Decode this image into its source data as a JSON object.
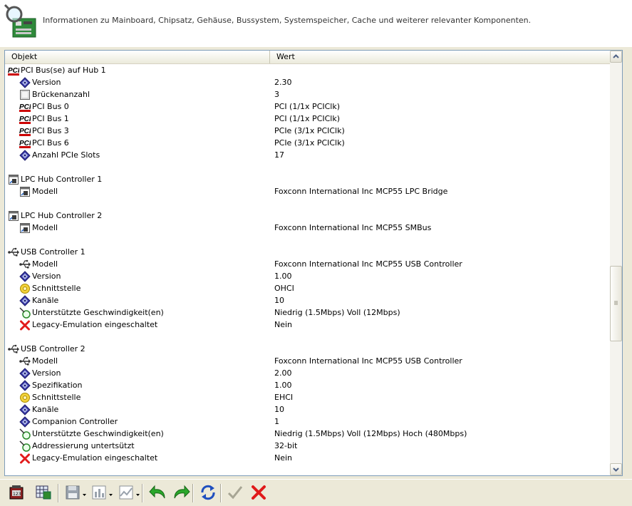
{
  "header": {
    "description": "Informationen zu Mainboard, Chipsatz, Gehäuse, Bussystem, Systemspeicher, Cache und weiterer relevanter Komponenten."
  },
  "columns": {
    "object": "Objekt",
    "value": "Wert"
  },
  "rows": [
    {
      "label": "PCI Bus(se) auf Hub 1",
      "value": "",
      "icon": "pci-icon",
      "level": 0
    },
    {
      "label": "Version",
      "value": "2.30",
      "icon": "diamond-info-icon",
      "level": 1
    },
    {
      "label": "Brückenanzahl",
      "value": "3",
      "icon": "square-gray-icon",
      "level": 1
    },
    {
      "label": "PCI Bus 0",
      "value": "PCI (1/1x PCIClk)",
      "icon": "pci-icon",
      "level": 1
    },
    {
      "label": "PCI Bus 1",
      "value": "PCI (1/1x PCIClk)",
      "icon": "pci-icon",
      "level": 1
    },
    {
      "label": "PCI Bus 3",
      "value": "PCIe (3/1x PCIClk)",
      "icon": "pci-icon",
      "level": 1
    },
    {
      "label": "PCI Bus 6",
      "value": "PCIe (3/1x PCIClk)",
      "icon": "pci-icon",
      "level": 1
    },
    {
      "label": "Anzahl PCIe Slots",
      "value": "17",
      "icon": "diamond-info-icon",
      "level": 1
    },
    {
      "label": "",
      "value": "",
      "icon": "",
      "level": 0
    },
    {
      "label": "LPC Hub Controller 1",
      "value": "",
      "icon": "window-chip-icon",
      "level": 0
    },
    {
      "label": "Modell",
      "value": "Foxconn International Inc MCP55 LPC Bridge",
      "icon": "window-chip-icon",
      "level": 1
    },
    {
      "label": "",
      "value": "",
      "icon": "",
      "level": 0
    },
    {
      "label": "LPC Hub Controller 2",
      "value": "",
      "icon": "window-chip-icon",
      "level": 0
    },
    {
      "label": "Modell",
      "value": "Foxconn International Inc MCP55 SMBus",
      "icon": "window-chip-icon",
      "level": 1
    },
    {
      "label": "",
      "value": "",
      "icon": "",
      "level": 0
    },
    {
      "label": "USB Controller 1",
      "value": "",
      "icon": "usb-icon",
      "level": 0
    },
    {
      "label": "Modell",
      "value": "Foxconn International Inc MCP55 USB Controller",
      "icon": "usb-icon",
      "level": 1
    },
    {
      "label": "Version",
      "value": "1.00",
      "icon": "diamond-info-icon",
      "level": 1
    },
    {
      "label": "Schnittstelle",
      "value": "OHCI",
      "icon": "yellow-disc-icon",
      "level": 1
    },
    {
      "label": "Kanäle",
      "value": "10",
      "icon": "diamond-info-icon",
      "level": 1
    },
    {
      "label": "Unterstützte Geschwindigkeit(en)",
      "value": "Niedrig (1.5Mbps) Voll (12Mbps)",
      "icon": "speed-gauge-icon",
      "level": 1
    },
    {
      "label": "Legacy-Emulation eingeschaltet",
      "value": "Nein",
      "icon": "red-x-icon",
      "level": 1
    },
    {
      "label": "",
      "value": "",
      "icon": "",
      "level": 0
    },
    {
      "label": "USB Controller 2",
      "value": "",
      "icon": "usb-icon",
      "level": 0
    },
    {
      "label": "Modell",
      "value": "Foxconn International Inc MCP55 USB Controller",
      "icon": "usb-icon",
      "level": 1
    },
    {
      "label": "Version",
      "value": "2.00",
      "icon": "diamond-info-icon",
      "level": 1
    },
    {
      "label": "Spezifikation",
      "value": "1.00",
      "icon": "diamond-info-icon",
      "level": 1
    },
    {
      "label": "Schnittstelle",
      "value": "EHCI",
      "icon": "yellow-disc-icon",
      "level": 1
    },
    {
      "label": "Kanäle",
      "value": "10",
      "icon": "diamond-info-icon",
      "level": 1
    },
    {
      "label": "Companion Controller",
      "value": "1",
      "icon": "diamond-info-icon",
      "level": 1
    },
    {
      "label": "Unterstützte Geschwindigkeit(en)",
      "value": "Niedrig (1.5Mbps) Voll (12Mbps) Hoch (480Mbps)",
      "icon": "speed-gauge-icon",
      "level": 1
    },
    {
      "label": "Addressierung untertsützt",
      "value": "32-bit",
      "icon": "speed-gauge-icon",
      "level": 1
    },
    {
      "label": "Legacy-Emulation eingeschaltet",
      "value": "Nein",
      "icon": "red-x-icon",
      "level": 1
    }
  ],
  "toolbar": [
    {
      "name": "hardware-report-button",
      "icon": "chip-report-icon"
    },
    {
      "name": "system-info-button",
      "icon": "grid-chip-icon"
    },
    {
      "name": "save-button",
      "icon": "floppy-icon",
      "dropdown": true
    },
    {
      "name": "report-button",
      "icon": "report-icon",
      "dropdown": true
    },
    {
      "name": "chart-button",
      "icon": "chart-icon",
      "dropdown": true
    },
    {
      "name": "back-button",
      "icon": "undo-arrow-icon"
    },
    {
      "name": "forward-button",
      "icon": "redo-arrow-icon"
    },
    {
      "name": "refresh-button",
      "icon": "refresh-icon"
    },
    {
      "name": "ok-button",
      "icon": "checkmark-icon"
    },
    {
      "name": "cancel-button",
      "icon": "red-x-icon"
    }
  ]
}
